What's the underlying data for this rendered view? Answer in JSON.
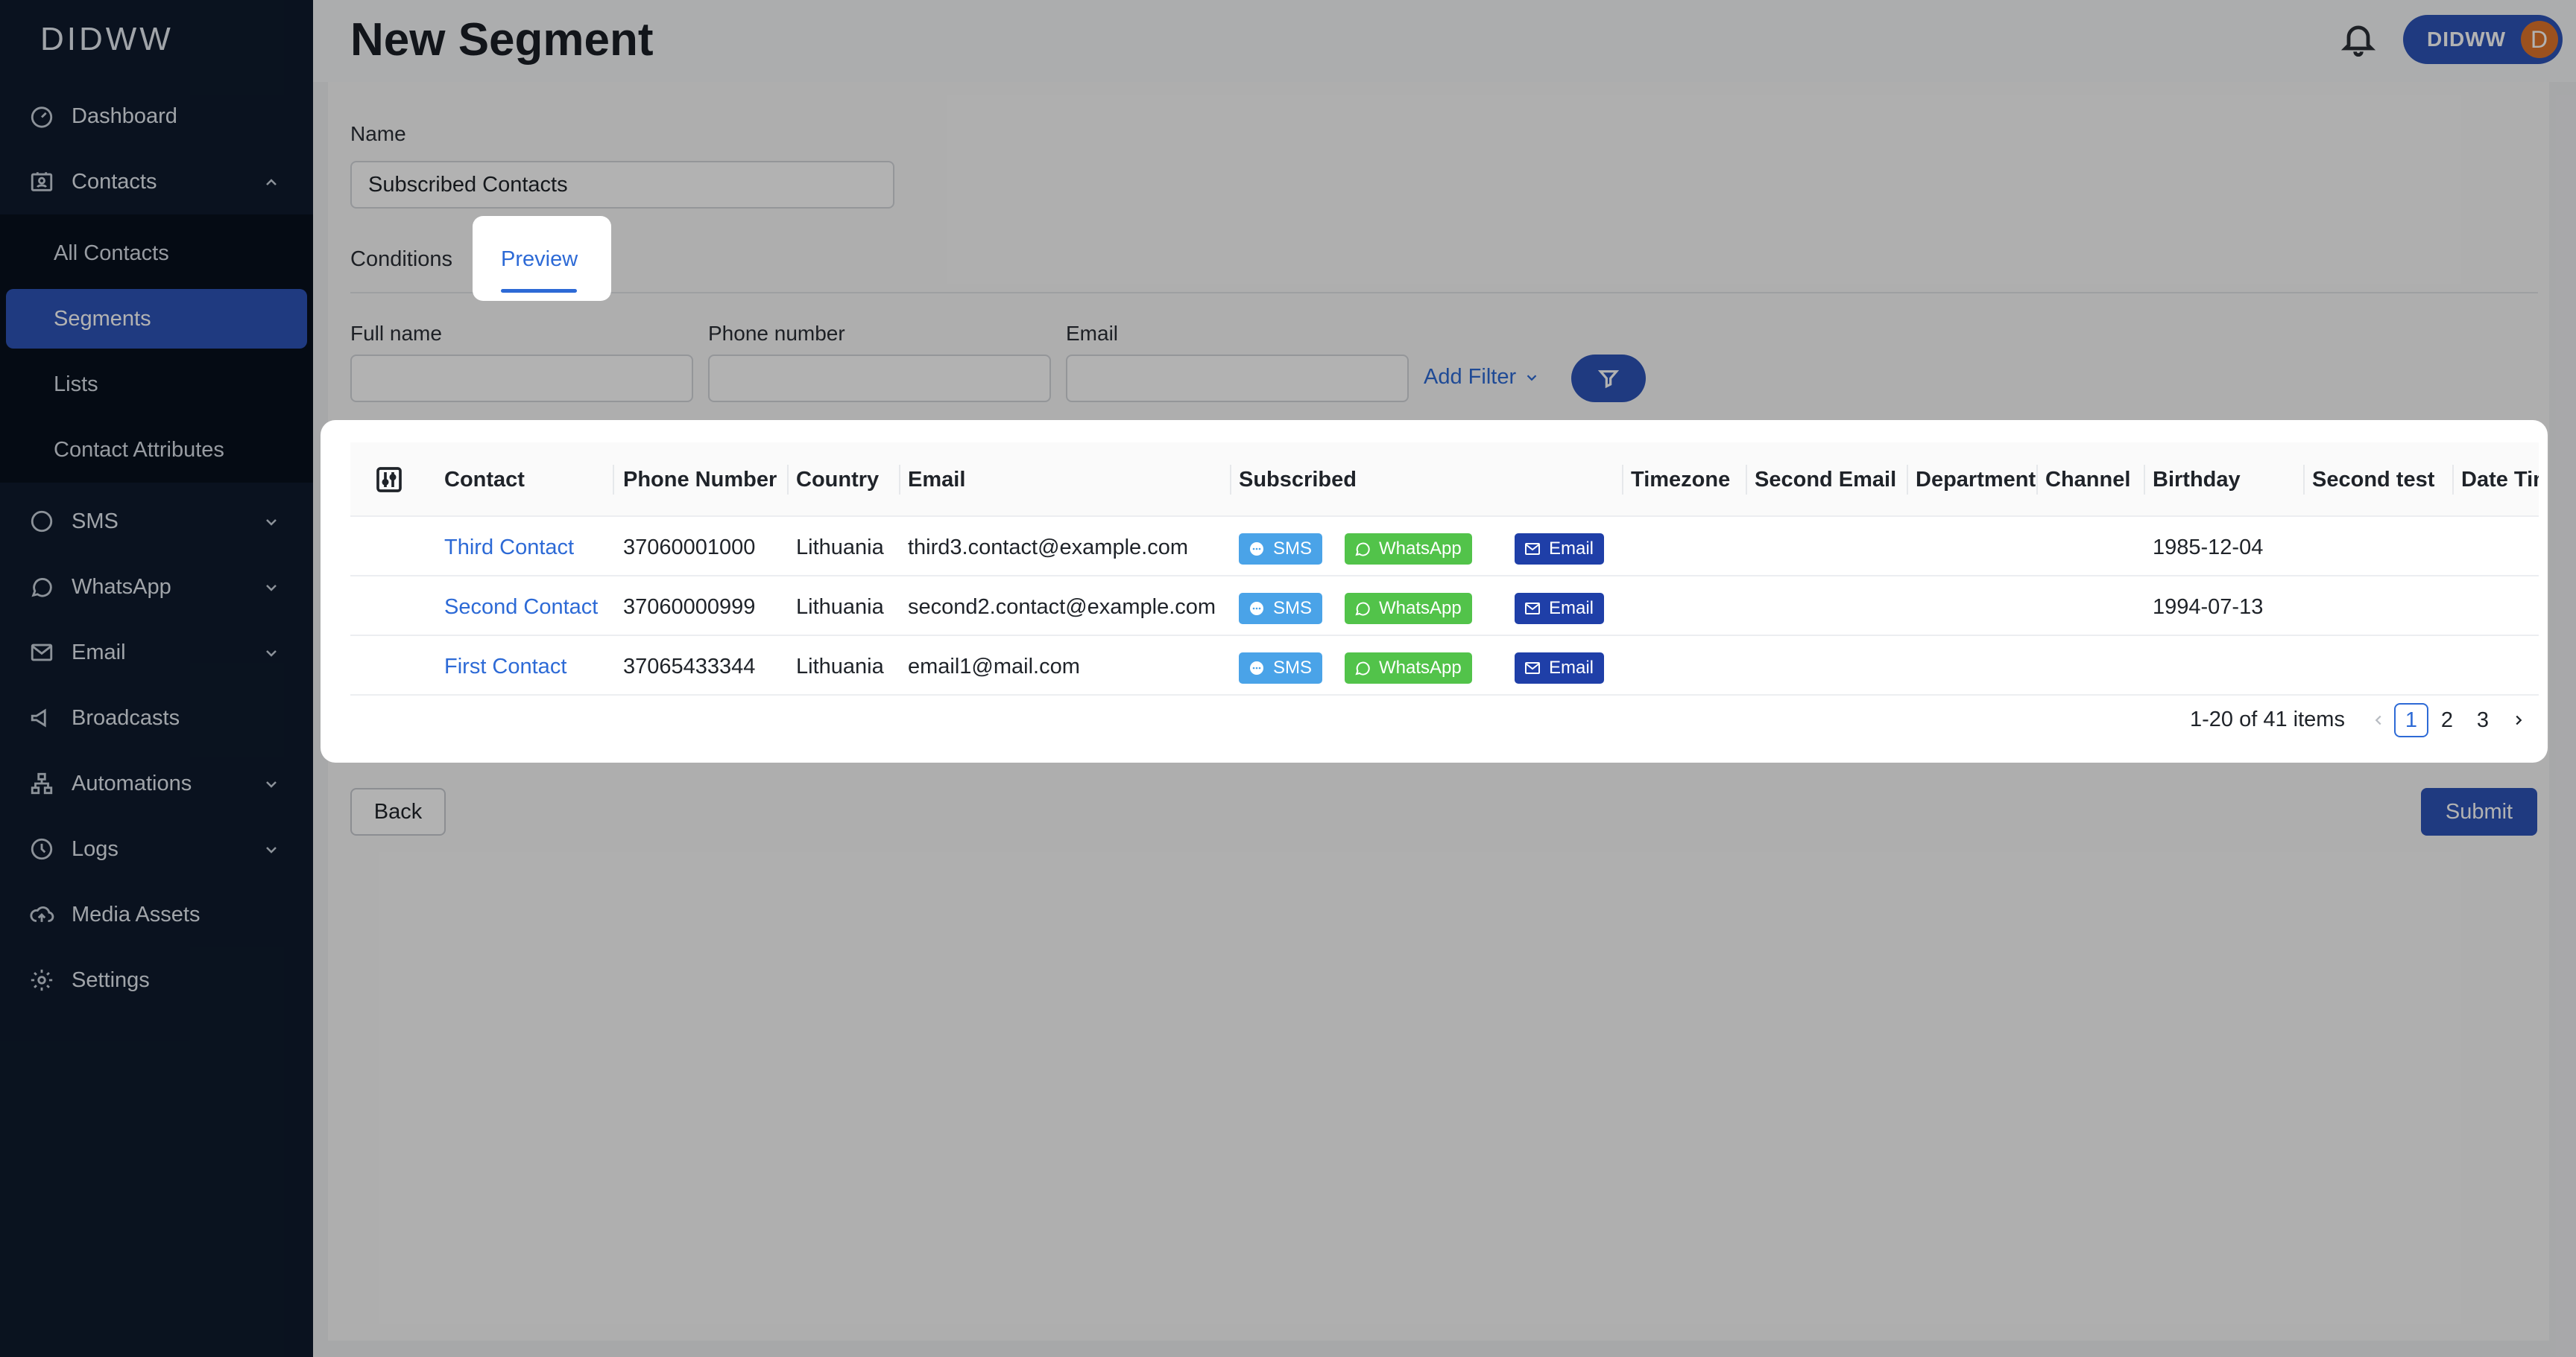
{
  "sidebar": {
    "logo": "DIDWW",
    "items": [
      {
        "label": "Dashboard",
        "icon": "dashboard-icon"
      },
      {
        "label": "Contacts",
        "icon": "contacts-icon"
      },
      {
        "label": "SMS",
        "icon": "sms-icon"
      },
      {
        "label": "WhatsApp",
        "icon": "whatsapp-icon"
      },
      {
        "label": "Email",
        "icon": "email-icon"
      },
      {
        "label": "Broadcasts",
        "icon": "broadcast-icon"
      },
      {
        "label": "Automations",
        "icon": "automations-icon"
      },
      {
        "label": "Logs",
        "icon": "logs-icon"
      },
      {
        "label": "Media Assets",
        "icon": "cloud-upload-icon"
      },
      {
        "label": "Settings",
        "icon": "gear-icon"
      }
    ],
    "contacts_sub": [
      "All Contacts",
      "Segments",
      "Lists",
      "Contact Attributes"
    ]
  },
  "header": {
    "title": "New Segment",
    "user": "DIDWW",
    "avatar_letter": "D"
  },
  "form": {
    "name_label": "Name",
    "name_value": "Subscribed Contacts"
  },
  "tabs": [
    "Conditions",
    "Preview"
  ],
  "filters": {
    "full_name_label": "Full name",
    "phone_label": "Phone number",
    "email_label": "Email",
    "add_filter": "Add Filter"
  },
  "table": {
    "columns": [
      "Contact",
      "Phone Number",
      "Country",
      "Email",
      "Subscribed",
      "Timezone",
      "Second Email",
      "Department",
      "Channel",
      "Birthday",
      "Second test",
      "Date Time"
    ],
    "badges": {
      "sms": "SMS",
      "whatsapp": "WhatsApp",
      "email": "Email"
    },
    "rows": [
      {
        "contact": "Third Contact",
        "phone": "37060001000",
        "country": "Lithuania",
        "email": "third3.contact@example.com",
        "birthday": "1985-12-04"
      },
      {
        "contact": "Second Contact",
        "phone": "37060000999",
        "country": "Lithuania",
        "email": "second2.contact@example.com",
        "birthday": "1994-07-13"
      },
      {
        "contact": "First Contact",
        "phone": "37065433344",
        "country": "Lithuania",
        "email": "email1@mail.com",
        "birthday": ""
      }
    ]
  },
  "pagination": {
    "summary": "1-20 of 41 items",
    "pages": [
      "1",
      "2",
      "3"
    ],
    "current": "1"
  },
  "actions": {
    "back": "Back",
    "submit": "Submit"
  }
}
